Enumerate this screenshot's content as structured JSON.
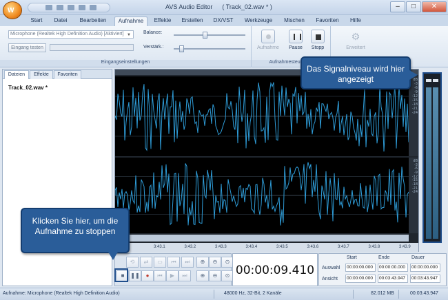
{
  "window": {
    "app_name": "AVS Audio Editor",
    "document": "( Track_02.wav * )"
  },
  "quick_access": {
    "icons": [
      "new-icon",
      "open-icon",
      "save-icon",
      "undo-icon",
      "redo-icon"
    ]
  },
  "ribbon_tabs": [
    "Start",
    "Datei",
    "Bearbeiten",
    "Aufnahme",
    "Effekte",
    "Erstellen",
    "DX/VST",
    "Werkzeuge",
    "Mischen",
    "Favoriten",
    "Hilfe"
  ],
  "active_tab": "Aufnahme",
  "input_group": {
    "device": "Microphone (Realtek High Definition Audio) [Aktiviert]",
    "test_button": "Eingang testen",
    "balance_label": "Balance:",
    "gain_label": "Verstärk.:",
    "group_label": "Eingangseinstellungen"
  },
  "record_group": {
    "record_label": "Aufnahme",
    "pause_label": "Pause",
    "stop_label": "Stopp",
    "group_label": "Aufnahmesteuerung"
  },
  "advanced_label": "Erweitert",
  "panel": {
    "tabs": [
      "Dateien",
      "Effekte",
      "Favoriten"
    ],
    "files": [
      "Track_02.wav *"
    ]
  },
  "db_ticks": [
    "dB",
    "-3",
    "-6",
    "-9",
    "-12",
    "-15",
    "-18",
    "-21",
    "-24"
  ],
  "timeline_ticks": [
    "3:43.1",
    "3:43.2",
    "3:43.3",
    "3:43.4",
    "3:43.5",
    "3:43.6",
    "3:43.7",
    "3:43.8",
    "3:43.9"
  ],
  "counter": "00:00:09.410",
  "time_grid": {
    "headers": [
      "Start",
      "Ende",
      "Dauer"
    ],
    "rows": [
      {
        "label": "Auswahl",
        "values": [
          "00:00:00.000",
          "00:00:00.000",
          "00:00:00.000"
        ]
      },
      {
        "label": "Ansicht",
        "values": [
          "00:00:00.000",
          "00:03:43.947",
          "00:03:43.947"
        ]
      }
    ]
  },
  "status": {
    "recording": "Aufnahme: Microphone (Realtek High Definition Audio)",
    "format": "48000 Hz, 32-Bit, 2 Kanäle",
    "size": "82.012 MB",
    "length": "00:03:43.947"
  },
  "callouts": {
    "meter": "Das Signalniveau wird hier angezeigt",
    "stop": "Klicken Sie hier, um die Aufnahme zu stoppen"
  },
  "colors": {
    "waveform": "#2e9bd6",
    "callout": "#2a5d99",
    "highlight": "#1f4e8c"
  },
  "meter_level": {
    "left": 0.9,
    "right": 0.9
  }
}
